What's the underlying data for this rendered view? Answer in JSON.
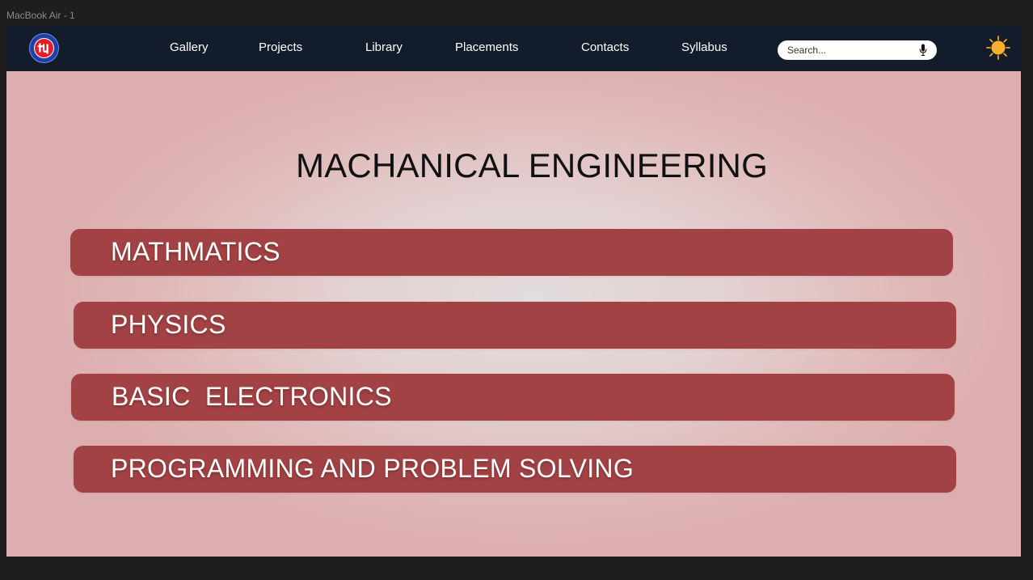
{
  "frame": {
    "label": "MacBook Air - 1"
  },
  "nav": {
    "links": [
      {
        "label": "Gallery"
      },
      {
        "label": "Projects"
      },
      {
        "label": "Library"
      },
      {
        "label": "Placements"
      },
      {
        "label": "Contacts"
      },
      {
        "label": "Syllabus"
      }
    ],
    "search": {
      "placeholder": "Search...",
      "value": ""
    },
    "icons": {
      "logo": "college-logo",
      "mic": "microphone-icon",
      "theme": "sun-icon"
    }
  },
  "main": {
    "title": "MACHANICAL ENGINEERING",
    "subjects": [
      {
        "label": "MATHMATICS"
      },
      {
        "label": "PHYSICS"
      },
      {
        "label": "BASIC  ELECTRONICS"
      },
      {
        "label": "PROGRAMMING AND PROBLEM SOLVING"
      }
    ]
  },
  "colors": {
    "navbar": "#121c2b",
    "subject_button": "#a34244",
    "background_center": "#e2dcdc",
    "background_edge": "#ddaeaf",
    "sun": "#f5a623"
  }
}
